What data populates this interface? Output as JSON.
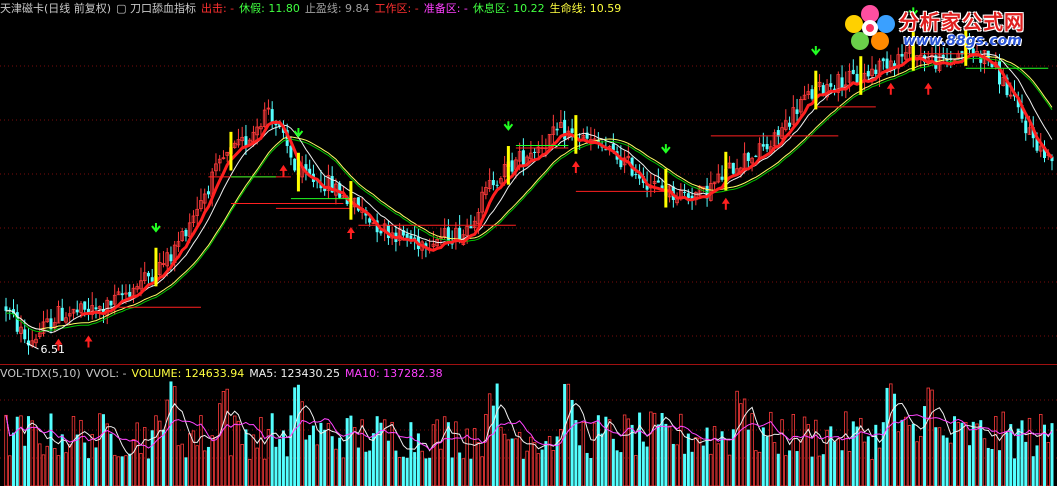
{
  "colors": {
    "background": "#000000",
    "up": "#ff3b3b",
    "down": "#54ffff",
    "separator": "#a01010",
    "grid": "#7a0b0b",
    "ma_thick_red": "#ff2020",
    "ma_white": "#f0f0f0",
    "ma_yellow": "#ffff66",
    "ma_green": "#00c000",
    "stop_line": "#ff2020",
    "signal_green": "#22ff22",
    "signal_yellow": "#ffff00",
    "arrow_red": "#ff2020",
    "vol_ma5": "#f0f0f0",
    "vol_ma10": "#ff44ff"
  },
  "main_legend": [
    {
      "text": "天津磁卡(日线 前复权)",
      "color": "#c8c8c8"
    },
    {
      "text": "▢ 刀口舔血指标",
      "color": "#c8c8c8"
    },
    {
      "text": "出击: -",
      "color": "#ff3030"
    },
    {
      "text": "休假: 11.80",
      "color": "#40ff40"
    },
    {
      "text": "止盈线: 9.84",
      "color": "#a0a0a0"
    },
    {
      "text": "工作区: -",
      "color": "#ff3030"
    },
    {
      "text": "准备区: -",
      "color": "#ff40ff"
    },
    {
      "text": "休息区: 10.22",
      "color": "#40ff40"
    },
    {
      "text": "生命线: 10.59",
      "color": "#ffff40"
    }
  ],
  "volume_legend": [
    {
      "text": "VOL-TDX(5,10)",
      "color": "#c8c8c8"
    },
    {
      "text": "VVOL: -",
      "color": "#c8c8c8"
    },
    {
      "text": "VOLUME: 124633.94",
      "color": "#ffff40"
    },
    {
      "text": "MA5: 123430.25",
      "color": "#f0f0f0"
    },
    {
      "text": "MA10: 137282.38",
      "color": "#ff40ff"
    }
  ],
  "watermark": {
    "title": "分析家公式网",
    "url": "www.88gs.com"
  },
  "chart_data": {
    "type": "candlestick",
    "title": "天津磁卡(日线 前复权)",
    "price_range": [
      6.2,
      13.2
    ],
    "low_marker": {
      "index": 6,
      "label": "6.51"
    },
    "pivots": [
      [
        0,
        7.25
      ],
      [
        5,
        6.6
      ],
      [
        6,
        6.51
      ],
      [
        14,
        7.1
      ],
      [
        26,
        7.2
      ],
      [
        38,
        7.9
      ],
      [
        44,
        8.3
      ],
      [
        52,
        9.5
      ],
      [
        58,
        10.3
      ],
      [
        64,
        10.7
      ],
      [
        70,
        11.4
      ],
      [
        78,
        10.0
      ],
      [
        86,
        9.8
      ],
      [
        100,
        8.9
      ],
      [
        110,
        8.6
      ],
      [
        122,
        8.8
      ],
      [
        130,
        9.9
      ],
      [
        140,
        10.5
      ],
      [
        148,
        10.9
      ],
      [
        158,
        10.6
      ],
      [
        166,
        10.2
      ],
      [
        172,
        9.8
      ],
      [
        178,
        9.6
      ],
      [
        186,
        9.6
      ],
      [
        196,
        10.3
      ],
      [
        204,
        10.6
      ],
      [
        212,
        11.5
      ],
      [
        220,
        11.9
      ],
      [
        228,
        12.0
      ],
      [
        236,
        12.4
      ],
      [
        242,
        12.5
      ],
      [
        250,
        12.3
      ],
      [
        256,
        12.6
      ],
      [
        262,
        12.4
      ],
      [
        266,
        11.9
      ],
      [
        272,
        11.0
      ],
      [
        278,
        10.3
      ]
    ],
    "stop_lines": [
      {
        "from": 30,
        "to": 52,
        "price": 7.25
      },
      {
        "from": 54,
        "to": 76,
        "price": 9.95
      },
      {
        "from": 60,
        "to": 90,
        "price": 9.4
      },
      {
        "from": 72,
        "to": 92,
        "price": 9.3
      },
      {
        "from": 94,
        "to": 136,
        "price": 8.95
      },
      {
        "from": 136,
        "to": 150,
        "price": 10.55
      },
      {
        "from": 152,
        "to": 178,
        "price": 9.65
      },
      {
        "from": 188,
        "to": 222,
        "price": 10.8
      },
      {
        "from": 216,
        "to": 232,
        "price": 11.4
      },
      {
        "from": 244,
        "to": 260,
        "price": 12.5
      }
    ],
    "buy_arrows": [
      14,
      22,
      74,
      92,
      152,
      192,
      236,
      246
    ],
    "signal_bars": [
      40,
      60,
      78,
      92,
      134,
      152,
      176,
      192,
      216,
      228,
      242,
      256
    ],
    "watch_lines_green": [
      {
        "from": 60,
        "to": 72,
        "price": 9.95
      },
      {
        "from": 76,
        "to": 92,
        "price": 9.5
      },
      {
        "from": 136,
        "to": 150,
        "price": 10.6
      },
      {
        "from": 256,
        "to": 278,
        "price": 12.2
      }
    ],
    "volume": {
      "ma5_last": 123430.25,
      "ma10_last": 137282.38,
      "last": 124633.94
    }
  }
}
